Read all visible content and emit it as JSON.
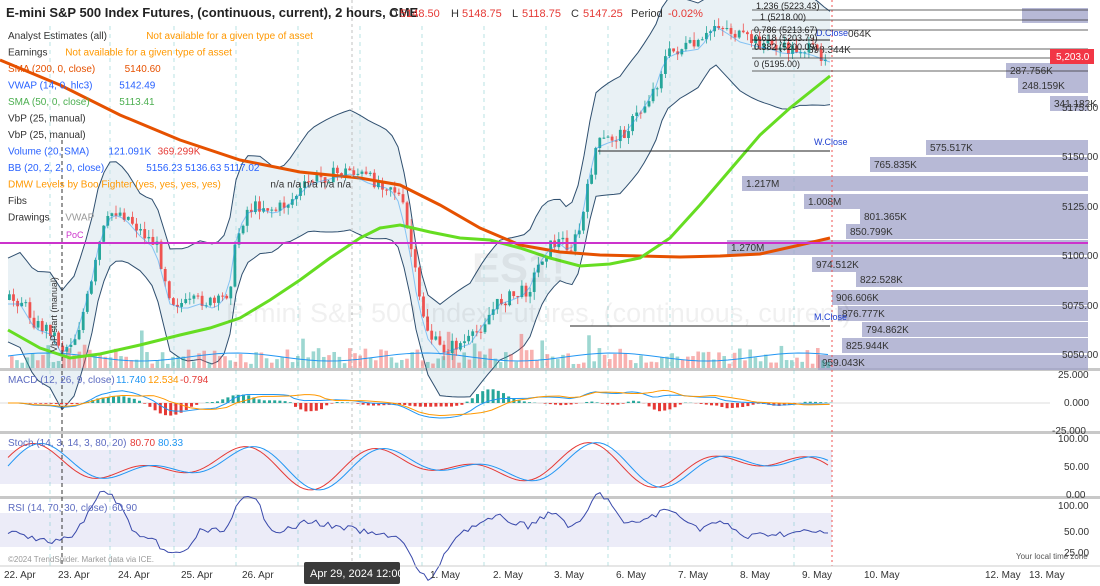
{
  "header": {
    "symbol": "E-mini S&P 500 Index Futures, (continuous, current), 2 hours, CME",
    "o_lbl": "O",
    "o_val": "5148.50",
    "h_lbl": "H",
    "h_val": "5148.75",
    "l_lbl": "L",
    "l_val": "5118.75",
    "c_lbl": "C",
    "c_val": "5147.25",
    "period_lbl": "Period",
    "period_val": "-0.02%"
  },
  "legend": [
    {
      "label": "Analyst Estimates (all)",
      "value": "Not available for a given type of asset",
      "value_color": "#ff9800"
    },
    {
      "label": "Earnings",
      "value": "Not available for a given type of asset",
      "value_color": "#ff9800"
    },
    {
      "label": "SMA (200, 0, close)",
      "value": "5140.60",
      "label_color": "#e65100",
      "value_color": "#e65100"
    },
    {
      "label": "VWAP (14, 0, hlc3)",
      "value": "5142.49",
      "label_color": "#2962ff",
      "value_color": "#2962ff"
    },
    {
      "label": "SMA (50, 0, close)",
      "value": "5113.41",
      "label_color": "#4caf50",
      "value_color": "#4caf50"
    },
    {
      "label": "VbP (25, manual)",
      "value": ""
    },
    {
      "label": "VbP (25, manual)",
      "value": ""
    },
    {
      "label": "Volume (20, SMA)",
      "value": "121.091K",
      "value2": "369.299K",
      "label_color": "#2962ff",
      "value_color": "#2962ff",
      "value2_color": "#e53935"
    },
    {
      "label": "BB (20, 2, 2, 0, close)",
      "value": "5156.23 5136.63 5117.02",
      "label_color": "#2962ff",
      "value_color": "#2962ff"
    },
    {
      "label": "DMW Levels by Boo Fighter (yes, yes, yes, yes)",
      "value": "n/a n/a n/a n/a n/a",
      "label_color": "#ff9800",
      "value_color": "#333"
    },
    {
      "label": "Fibs",
      "value": ""
    },
    {
      "label": "Drawings",
      "value": "VWAP",
      "value_color": "#999"
    }
  ],
  "annotations": {
    "poc": "PoC",
    "vbp_start": "VbP start (manual)",
    "watermark1": "ES1!",
    "watermark2": "E-mini S&P 500 Index Futures, (continuous, current)",
    "fib_top1": "1.236 (5223.43)",
    "fib_top2": "1 (5218.00)",
    "fib_mid1": "0.786 (5213.67)",
    "fib_mid2": "0.618 (5203.79)",
    "fib_mid3": "0.382 (5200.09)",
    "fib_low": "0 (5195.00)",
    "d_close": "D.Close",
    "w_close": "W.Close",
    "m_close": "M.Close",
    "vol_pair": "898.344K",
    "vol_pair_hidden": "064K"
  },
  "price_axis": [
    "5175.00",
    "5150.00",
    "5125.00",
    "5100.00",
    "5075.00",
    "5050.00"
  ],
  "current_price": "5,203.0",
  "vbp_labels": [
    "287.756K",
    "248.159K",
    "341.182K",
    "575.517K",
    "765.835K",
    "1.217M",
    "1.008M",
    "801.365K",
    "850.799K",
    "1.270M",
    "974.512K",
    "822.528K",
    "906.606K",
    "876.777K",
    "794.862K",
    "825.944K",
    "959.043K"
  ],
  "macd": {
    "label": "MACD (12, 26, 9, close)",
    "v1": "11.740",
    "v2": "12.534",
    "v3": "-0.794",
    "axis": [
      "25.000",
      "0.000",
      "-25.000"
    ]
  },
  "stoch": {
    "label": "Stoch (14, 3, 14, 3, 80, 20)",
    "v1": "80.70",
    "v2": "80.33",
    "axis": [
      "100.00",
      "50.00",
      "0.00"
    ]
  },
  "rsi": {
    "label": "RSI (14, 70, 30, close)",
    "v1": "60.90",
    "axis": [
      "100.00",
      "50.00",
      "25.00"
    ]
  },
  "footer": {
    "copyright": "©2024 TrendSpider. Market data via ICE.",
    "local_time": "Your local time zone",
    "crosshair_date": "Apr 29, 2024 12:00"
  },
  "date_axis": [
    "22. Apr",
    "23. Apr",
    "24. Apr",
    "25. Apr",
    "26. Apr",
    "1. May",
    "2. May",
    "3. May",
    "6. May",
    "7. May",
    "8. May",
    "9. May",
    "10. May",
    "12. May",
    "13. May"
  ],
  "colors": {
    "up": "#26a69a",
    "down": "#ef5350",
    "sma200": "#e65100",
    "sma50": "#66dd22",
    "bb": "#2f4f6f",
    "vwap": "#2196f3",
    "poc": "#cc33cc",
    "vbp": "#9fa2c8"
  }
}
